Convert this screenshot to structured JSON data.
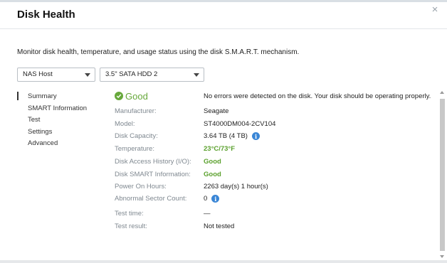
{
  "dialog": {
    "title": "Disk Health",
    "close_symbol": "×",
    "description": "Monitor disk health, temperature, and usage status using the disk S.M.A.R.T. mechanism."
  },
  "selectors": {
    "host": "NAS Host",
    "disk": "3.5\" SATA HDD 2"
  },
  "nav": {
    "items": [
      {
        "label": "Summary",
        "active": true
      },
      {
        "label": "SMART Information",
        "active": false
      },
      {
        "label": "Test",
        "active": false
      },
      {
        "label": "Settings",
        "active": false
      },
      {
        "label": "Advanced",
        "active": false
      }
    ]
  },
  "summary": {
    "status": "Good",
    "status_color": "#67a83b",
    "message": "No errors were detected on the disk. Your disk should be operating properly.",
    "fields": {
      "manufacturer": {
        "label": "Manufacturer:",
        "value": "Seagate"
      },
      "model": {
        "label": "Model:",
        "value": "ST4000DM004-2CV104"
      },
      "capacity": {
        "label": "Disk Capacity:",
        "value": "3.64 TB (4 TB)"
      },
      "temperature": {
        "label": "Temperature:",
        "value": "23°C/73°F"
      },
      "access_history": {
        "label": "Disk Access History (I/O):",
        "value": "Good"
      },
      "smart_info": {
        "label": "Disk SMART Information:",
        "value": "Good"
      },
      "power_on": {
        "label": "Power On Hours:",
        "value": "2263 day(s) 1 hour(s)"
      },
      "abnormal_sector": {
        "label": "Abnormal Sector Count:",
        "value": "0"
      },
      "test_time": {
        "label": "Test time:",
        "value": "—"
      },
      "test_result": {
        "label": "Test result:",
        "value": "Not tested"
      }
    }
  },
  "icons": {
    "info": "i",
    "check": "check-icon"
  },
  "colors": {
    "good_green": "#5aa02c",
    "info_blue": "#3a86d6"
  }
}
